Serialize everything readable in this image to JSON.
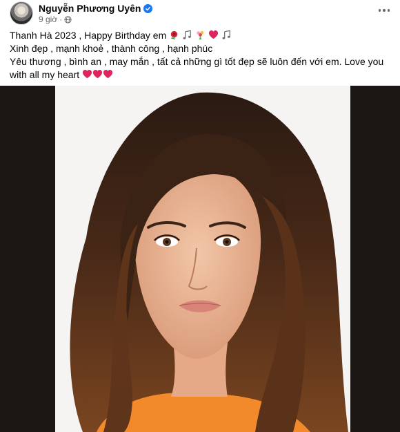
{
  "post": {
    "author": "Nguyễn Phương Uyên",
    "time": "9 giờ",
    "dot": "·",
    "verified": true,
    "privacy_icon": "globe-icon",
    "more_icon": "more-options-icon"
  },
  "caption": {
    "line1": "Thanh Hà 2023 , Happy Birthday em",
    "line1_emojis": [
      "rose-emoji",
      "music-notes-emoji",
      "bouquet-emoji",
      "red-heart-emoji",
      "music-notes-emoji"
    ],
    "line2": "Xinh đẹp , mạnh khoẻ , thành công , hạnh phúc",
    "line3": "Yêu thương , bình an , may mắn , tất cả những gì tốt đẹp sẽ luôn đến với em. Love you with all my heart",
    "line3_emojis": [
      "red-heart-emoji",
      "red-heart-emoji",
      "red-heart-emoji"
    ]
  },
  "photo": {
    "subject": "portrait-photo"
  },
  "colors": {
    "verified_blue": "#1877f2",
    "meta_gray": "#65676b",
    "heart_red": "#e0245e",
    "frame_dark": "#1c1714",
    "shirt_orange": "#f28a2c"
  }
}
